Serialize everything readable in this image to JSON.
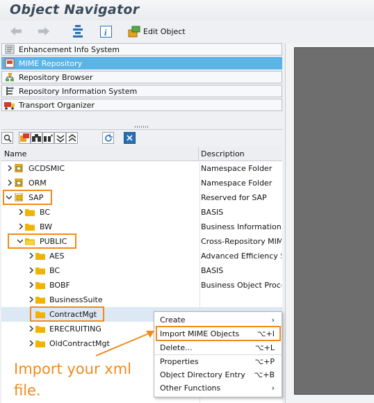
{
  "title": "Object Navigator",
  "toolbar": {
    "back_icon": "arrow-left-icon",
    "forward_icon": "arrow-right-icon",
    "edit_object_label": "Edit Object"
  },
  "nav_items": [
    {
      "label": "Enhancement Info System",
      "icon": "enhancement-icon"
    },
    {
      "label": "MIME Repository",
      "icon": "mime-icon",
      "selected": true
    },
    {
      "label": "Repository Browser",
      "icon": "browser-icon"
    },
    {
      "label": "Repository Information System",
      "icon": "info-system-icon"
    },
    {
      "label": "Transport Organizer",
      "icon": "truck-icon"
    }
  ],
  "tree": {
    "col_name": "Name",
    "col_desc": "Description",
    "rows": [
      {
        "name": "GCDSMIC",
        "desc": "Namespace Folder"
      },
      {
        "name": "ORM",
        "desc": "Namespace Folder"
      },
      {
        "name": "SAP",
        "desc": "Reserved for SAP"
      },
      {
        "name": "BC",
        "desc": "BASIS"
      },
      {
        "name": "BW",
        "desc": "Business Information"
      },
      {
        "name": "PUBLIC",
        "desc": "Cross-Repository MIM"
      },
      {
        "name": "AES",
        "desc": "Advanced Efficiency S"
      },
      {
        "name": "BC",
        "desc": "BASIS"
      },
      {
        "name": "BOBF",
        "desc": "Business Object Proce"
      },
      {
        "name": "BusinessSuite",
        "desc": ""
      },
      {
        "name": "ContractMgt",
        "desc": ""
      },
      {
        "name": "ERECRUITING",
        "desc": ""
      },
      {
        "name": "OldContractMgt",
        "desc": ""
      }
    ]
  },
  "context_menu": {
    "items": [
      {
        "label": "Create",
        "shortcut": "›"
      },
      {
        "label": "Import MIME Objects",
        "shortcut": "⌥+I"
      },
      {
        "label": "Delete...",
        "shortcut": "⌥+L"
      },
      {
        "label": "Properties",
        "shortcut": "⌥+P"
      },
      {
        "label": "Object Directory Entry",
        "shortcut": "⌥+B"
      },
      {
        "label": "Other Functions",
        "shortcut": "›"
      }
    ]
  },
  "annotation": {
    "line1": "Import your xml",
    "line2": "file."
  },
  "colors": {
    "accent": "#f08a1c",
    "selected": "#5ab4e6",
    "folder": "#f0b400"
  }
}
